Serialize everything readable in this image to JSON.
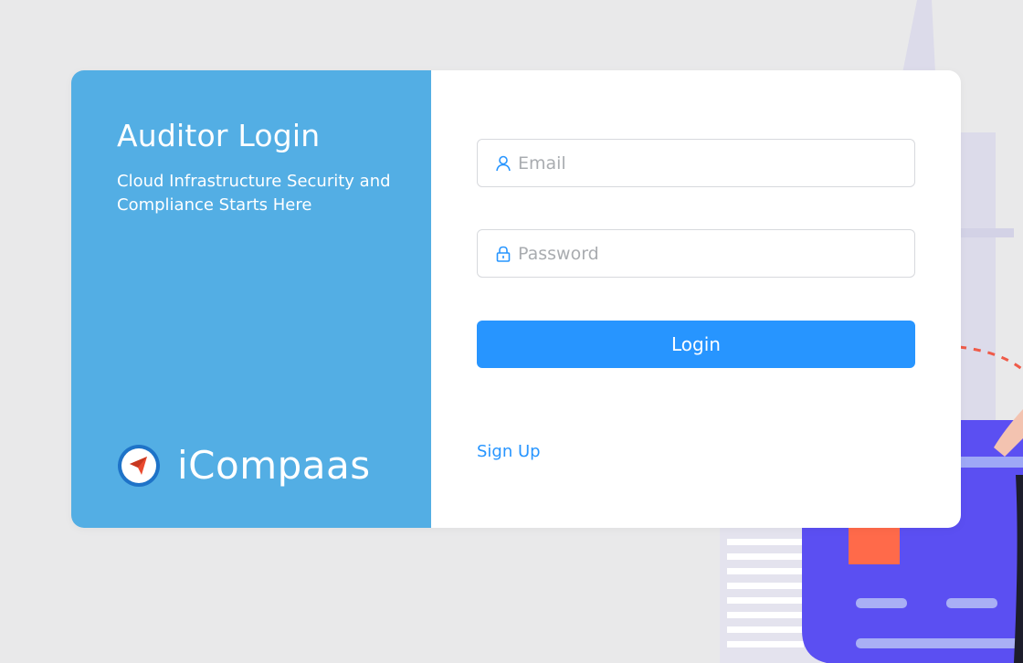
{
  "left_panel": {
    "title": "Auditor Login",
    "subtitle": "Cloud Infrastructure Security and Compliance Starts Here",
    "logo_text": "iCompaas",
    "background_color": "#53aee4"
  },
  "form": {
    "email": {
      "placeholder": "Email",
      "value": "",
      "icon": "user-icon"
    },
    "password": {
      "placeholder": "Password",
      "value": "",
      "icon": "lock-icon"
    },
    "login_label": "Login",
    "signup_label": "Sign Up",
    "accent_color": "#2795ff"
  },
  "background": {
    "color": "#e9e9ea",
    "illustration": "office-scene"
  }
}
